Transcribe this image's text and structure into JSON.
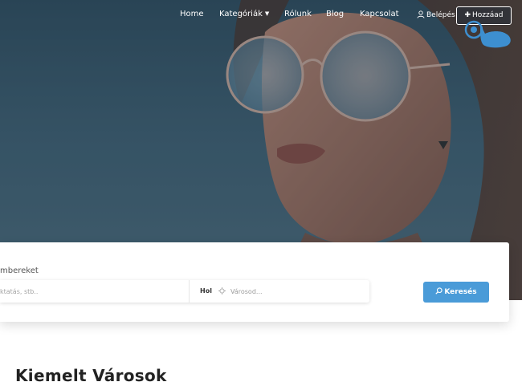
{
  "nav": {
    "items": [
      {
        "label": "Home"
      },
      {
        "label": "Kategóriák",
        "has_dropdown": true
      },
      {
        "label": "Rólunk"
      },
      {
        "label": "Blog"
      },
      {
        "label": "Kapcsolat"
      }
    ],
    "login_label": "Belépés",
    "add_label": "Hozzáad"
  },
  "search": {
    "title": "mbereket",
    "what_placeholder": "ktatás, stb..",
    "where_label": "Hol",
    "where_placeholder": "Városod...",
    "button_label": "Keresés"
  },
  "featured": {
    "title": "Kiemelt Városok"
  },
  "colors": {
    "accent": "#4a9bd8",
    "hero_overlay": "#3f5f72",
    "text_dark": "#222222"
  },
  "icons": {
    "login": "user-icon",
    "add": "plus-icon",
    "location": "crosshair-icon",
    "search": "search-icon",
    "pointer": "hand-pointer-icon"
  }
}
